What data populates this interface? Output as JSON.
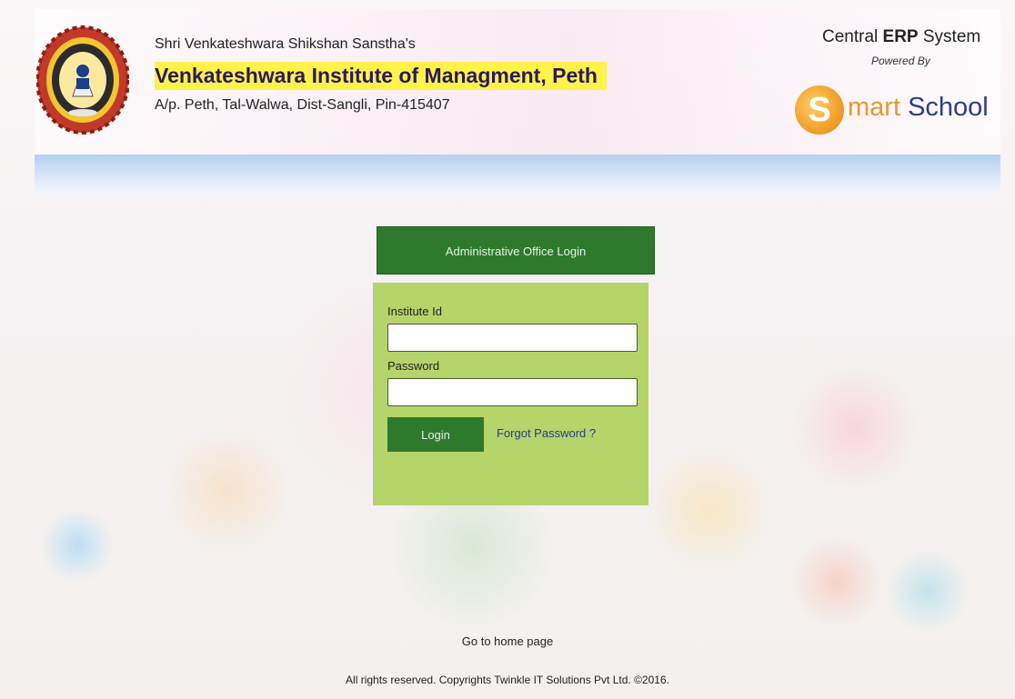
{
  "header": {
    "sanstha": "Shri Venkateshwara Shikshan Sanstha's",
    "institute_name": "Venkateshwara Institute of Managment, Peth",
    "address": "A/p. Peth, Tal-Walwa, Dist-Sangli, Pin-415407",
    "erp_prefix": "Central ",
    "erp_bold": "ERP",
    "erp_suffix": " System",
    "powered_by": "Powered By",
    "brand_initial": "S",
    "brand_mart": "mart ",
    "brand_school": "School",
    "highlight_color": "#fff24a"
  },
  "login": {
    "title": "Administrative Office Login",
    "institute_id_label": "Institute Id",
    "institute_id_value": "",
    "password_label": "Password",
    "password_value": "",
    "login_button": "Login",
    "forgot_password": "Forgot Password ?",
    "header_color": "#2d7a2d",
    "panel_color": "#b5d46a"
  },
  "footer": {
    "home_link": "Go to home page",
    "copyright": "All rights reserved. Copyrights Twinkle IT Solutions Pvt Ltd. ©2016."
  },
  "icons": {
    "logo": "institute-emblem-icon"
  }
}
